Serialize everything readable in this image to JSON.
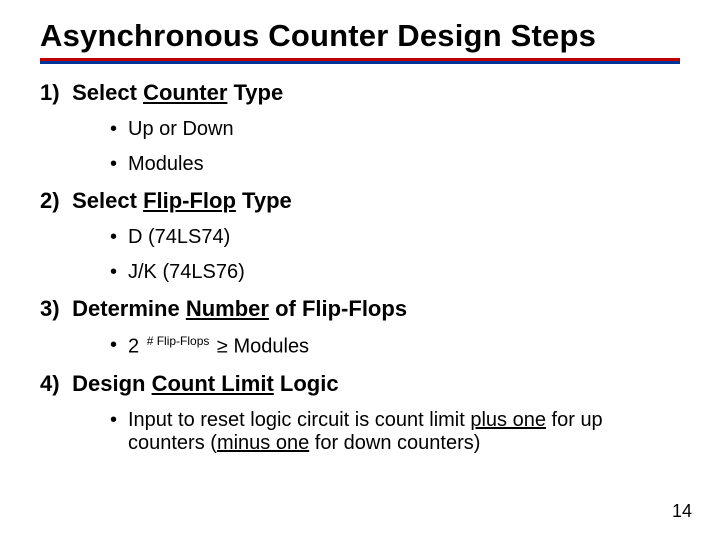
{
  "title": "Asynchronous Counter Design Steps",
  "page_number": "14",
  "steps": [
    {
      "num": "1)",
      "label_plain": "Select ",
      "label_under": "Counter",
      "label_tail": " Type",
      "bullets": [
        {
          "text": "Up or Down"
        },
        {
          "text": "Modules"
        }
      ]
    },
    {
      "num": "2)",
      "label_plain": "Select ",
      "label_under": "Flip-Flop",
      "label_tail": " Type",
      "bullets": [
        {
          "text": "D (74LS74)"
        },
        {
          "text": "J/K (74LS76)"
        }
      ]
    },
    {
      "num": "3)",
      "label_plain": "Determine ",
      "label_under": "Number",
      "label_tail": " of Flip-Flops",
      "bullets": [
        {
          "html": "2 <sup class='exp'># Flip-Flops</sup> ≥ Modules"
        }
      ]
    },
    {
      "num": "4)",
      "label_plain": "Design ",
      "label_under": "Count Limit",
      "label_tail": " Logic",
      "bullets": [
        {
          "html": "Input to reset logic circuit is count limit <u>plus one</u> for up counters (<u>minus one</u> for down counters)"
        }
      ]
    }
  ]
}
